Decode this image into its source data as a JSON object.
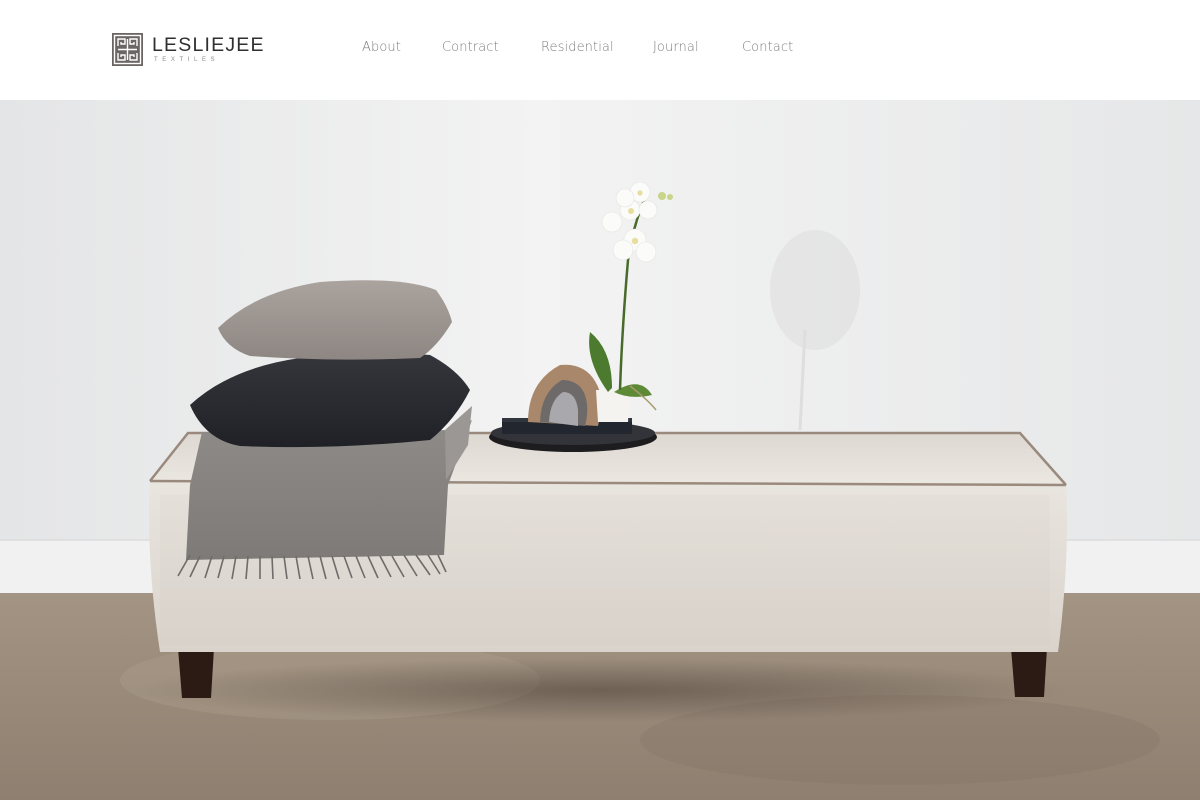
{
  "brand": {
    "name": "LESLIEJEE",
    "tagline": "TEXTILES",
    "logo_icon": "greek-key-emblem",
    "logo_color": "#6b6563"
  },
  "nav": {
    "items": [
      {
        "label": "About"
      },
      {
        "label": "Contract"
      },
      {
        "label": "Residential"
      },
      {
        "label": "Journal"
      },
      {
        "label": "Contact"
      }
    ]
  },
  "hero": {
    "image_subject": "upholstered-bench-photo",
    "colors": {
      "wall": "#ececec",
      "floor": "#958676",
      "bench_fabric": "#e4dfd8",
      "piping": "#9a8a7d",
      "dark_pillow": "#2a2b31",
      "light_pillow": "#a39c97",
      "throw": "#8c8986"
    }
  }
}
